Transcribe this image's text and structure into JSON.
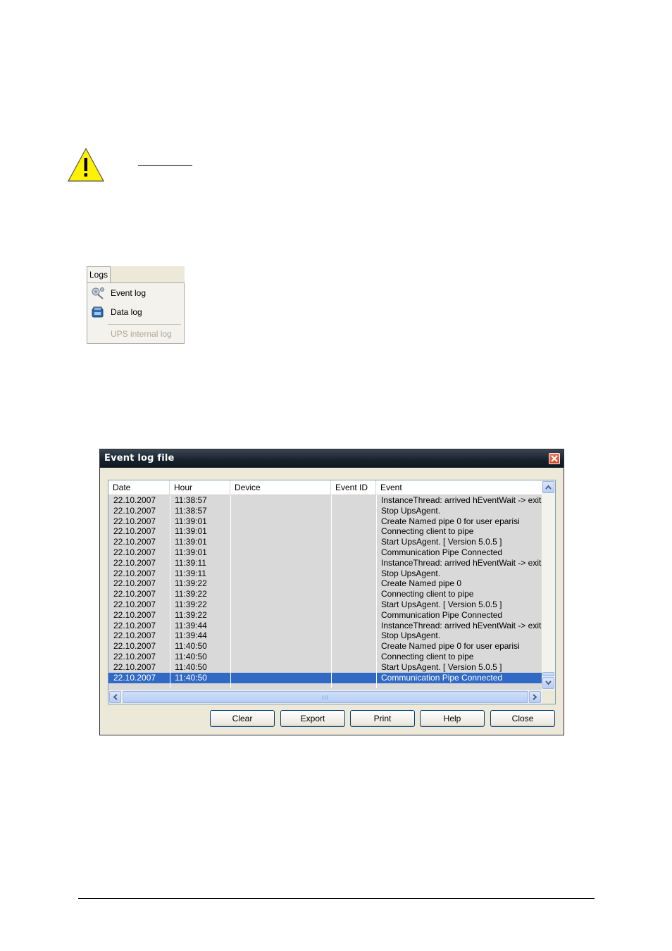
{
  "logs_menu": {
    "tab_label": "Logs",
    "items": [
      {
        "label": "Event log",
        "icon": "event-log-icon",
        "enabled": true
      },
      {
        "label": "Data log",
        "icon": "data-log-icon",
        "enabled": true
      },
      {
        "label": "UPS internal log",
        "icon": "",
        "enabled": false
      }
    ]
  },
  "dialog": {
    "title": "Event log file",
    "columns": [
      "Date",
      "Hour",
      "Device",
      "Event ID",
      "Event"
    ],
    "rows": [
      {
        "date": "22.10.2007",
        "hour": "11:38:57",
        "device": "",
        "event_id": "",
        "event": "InstanceThread: arrived hEventWait -> exit..."
      },
      {
        "date": "22.10.2007",
        "hour": "11:38:57",
        "device": "",
        "event_id": "",
        "event": "Stop UpsAgent."
      },
      {
        "date": "22.10.2007",
        "hour": "11:39:01",
        "device": "",
        "event_id": "",
        "event": "Create Named pipe 0 for user eparisi"
      },
      {
        "date": "22.10.2007",
        "hour": "11:39:01",
        "device": "",
        "event_id": "",
        "event": "Connecting client to pipe"
      },
      {
        "date": "22.10.2007",
        "hour": "11:39:01",
        "device": "",
        "event_id": "",
        "event": "Start UpsAgent.   [ Version 5.0.5 ]"
      },
      {
        "date": "22.10.2007",
        "hour": "11:39:01",
        "device": "",
        "event_id": "",
        "event": "Communication Pipe Connected"
      },
      {
        "date": "22.10.2007",
        "hour": "11:39:11",
        "device": "",
        "event_id": "",
        "event": "InstanceThread: arrived hEventWait -> exit..."
      },
      {
        "date": "22.10.2007",
        "hour": "11:39:11",
        "device": "",
        "event_id": "",
        "event": "Stop UpsAgent."
      },
      {
        "date": "22.10.2007",
        "hour": "11:39:22",
        "device": "",
        "event_id": "",
        "event": "Create Named pipe 0"
      },
      {
        "date": "22.10.2007",
        "hour": "11:39:22",
        "device": "",
        "event_id": "",
        "event": "Connecting client to pipe"
      },
      {
        "date": "22.10.2007",
        "hour": "11:39:22",
        "device": "",
        "event_id": "",
        "event": "Start UpsAgent.   [ Version 5.0.5 ]"
      },
      {
        "date": "22.10.2007",
        "hour": "11:39:22",
        "device": "",
        "event_id": "",
        "event": "Communication Pipe Connected"
      },
      {
        "date": "22.10.2007",
        "hour": "11:39:44",
        "device": "",
        "event_id": "",
        "event": "InstanceThread: arrived hEventWait -> exit..."
      },
      {
        "date": "22.10.2007",
        "hour": "11:39:44",
        "device": "",
        "event_id": "",
        "event": "Stop UpsAgent."
      },
      {
        "date": "22.10.2007",
        "hour": "11:40:50",
        "device": "",
        "event_id": "",
        "event": "Create Named pipe 0 for user eparisi"
      },
      {
        "date": "22.10.2007",
        "hour": "11:40:50",
        "device": "",
        "event_id": "",
        "event": "Connecting client to pipe"
      },
      {
        "date": "22.10.2007",
        "hour": "11:40:50",
        "device": "",
        "event_id": "",
        "event": "Start UpsAgent.   [ Version 5.0.5 ]"
      },
      {
        "date": "22.10.2007",
        "hour": "11:40:50",
        "device": "",
        "event_id": "",
        "event": "Communication Pipe Connected",
        "selected": true
      }
    ],
    "buttons": [
      "Clear",
      "Export",
      "Print",
      "Help",
      "Close"
    ]
  },
  "colors": {
    "selection": "#316ac5",
    "titlebar": "#16212c",
    "warning_yellow": "#fff200"
  }
}
